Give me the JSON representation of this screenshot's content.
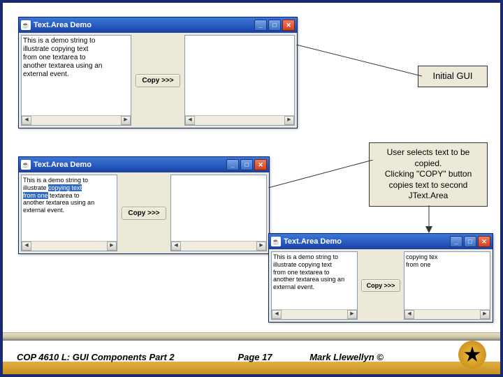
{
  "window_title": "Text.Area Demo",
  "copy_button": "Copy >>>",
  "demo_text": "This is a demo string to illustrate copying text from one textarea to another textarea using an external event.",
  "demo_text_lines": [
    "This is a demo string to",
    "illustrate copying text",
    "from one textarea to",
    "another textarea using an",
    "external event."
  ],
  "selected_word": "copying text",
  "copied_result": [
    "copying tex",
    "from one"
  ],
  "callouts": {
    "initial": "Initial GUI",
    "step2": "User selects text to be copied.\nClicking \"COPY\" button copies text to second\nJText.Area"
  },
  "footer": {
    "left": "COP 4610 L: GUI Components Part 2",
    "center": "Page 17",
    "right": "Mark Llewellyn ©"
  }
}
